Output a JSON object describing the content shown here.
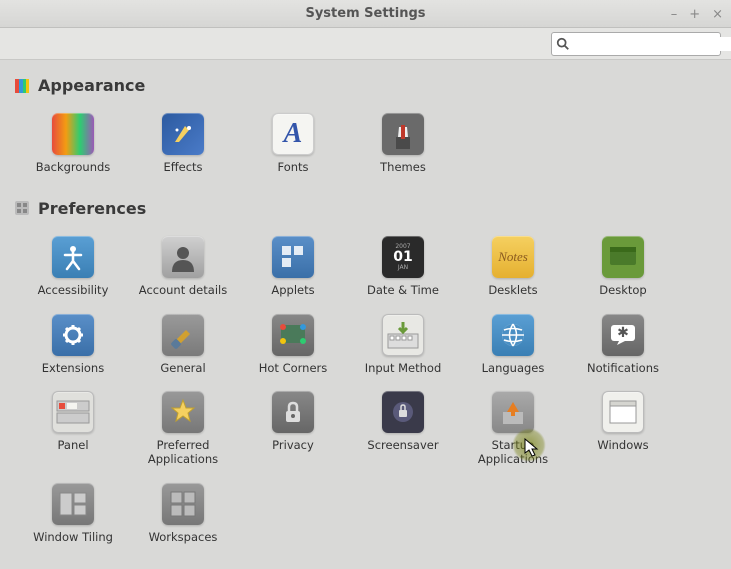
{
  "window": {
    "title": "System Settings",
    "controls": {
      "minimize": "–",
      "maximize": "+",
      "close": "×"
    }
  },
  "search": {
    "placeholder": ""
  },
  "sections": [
    {
      "id": "appearance",
      "title": "Appearance",
      "items": [
        {
          "id": "backgrounds",
          "label": "Backgrounds"
        },
        {
          "id": "effects",
          "label": "Effects"
        },
        {
          "id": "fonts",
          "label": "Fonts"
        },
        {
          "id": "themes",
          "label": "Themes"
        }
      ]
    },
    {
      "id": "preferences",
      "title": "Preferences",
      "items": [
        {
          "id": "accessibility",
          "label": "Accessibility"
        },
        {
          "id": "account-details",
          "label": "Account details"
        },
        {
          "id": "applets",
          "label": "Applets"
        },
        {
          "id": "date-time",
          "label": "Date & Time"
        },
        {
          "id": "desklets",
          "label": "Desklets"
        },
        {
          "id": "desktop",
          "label": "Desktop"
        },
        {
          "id": "extensions",
          "label": "Extensions"
        },
        {
          "id": "general",
          "label": "General"
        },
        {
          "id": "hot-corners",
          "label": "Hot Corners"
        },
        {
          "id": "input-method",
          "label": "Input Method"
        },
        {
          "id": "languages",
          "label": "Languages"
        },
        {
          "id": "notifications",
          "label": "Notifications"
        },
        {
          "id": "panel",
          "label": "Panel"
        },
        {
          "id": "preferred-applications",
          "label": "Preferred Applications"
        },
        {
          "id": "privacy",
          "label": "Privacy"
        },
        {
          "id": "screensaver",
          "label": "Screensaver"
        },
        {
          "id": "startup-applications",
          "label": "Startup Applications"
        },
        {
          "id": "windows",
          "label": "Windows"
        },
        {
          "id": "window-tiling",
          "label": "Window Tiling"
        },
        {
          "id": "workspaces",
          "label": "Workspaces"
        }
      ]
    }
  ]
}
